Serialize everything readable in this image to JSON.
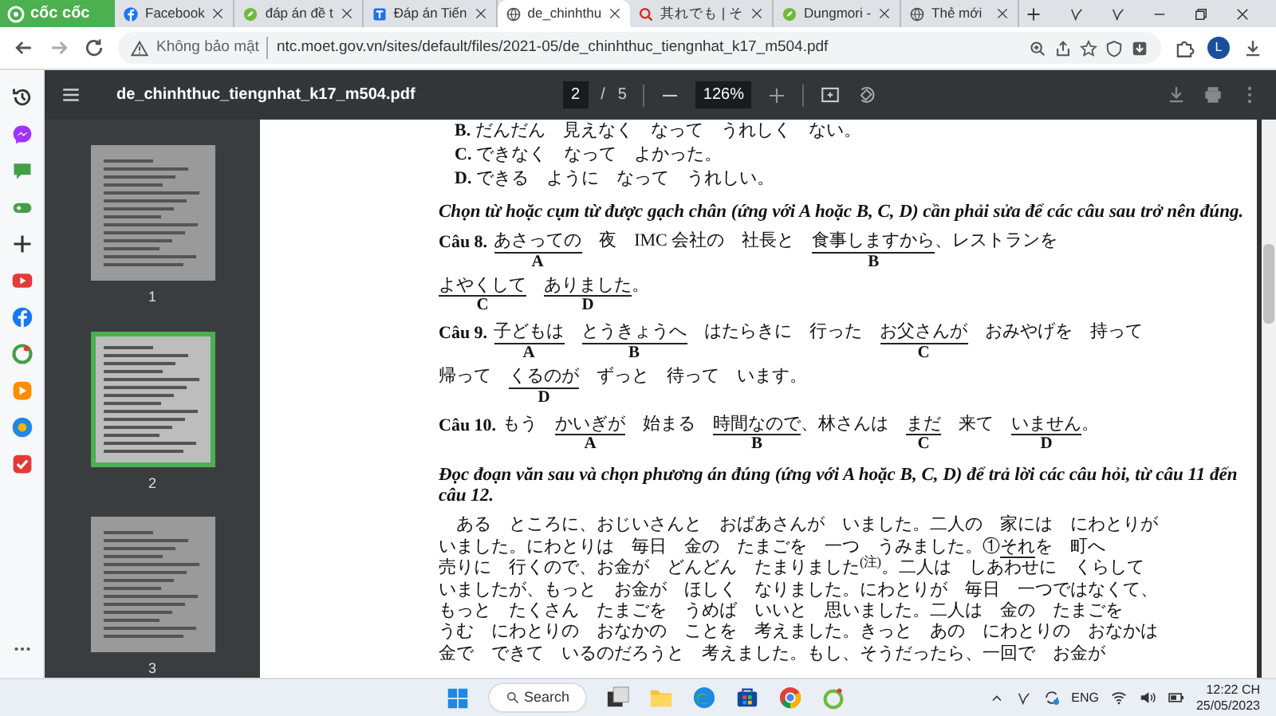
{
  "browser": {
    "brand": "cốc cốc",
    "tabs": [
      {
        "title": "Facebook",
        "selected": false
      },
      {
        "title": "đáp án đề t",
        "selected": false
      },
      {
        "title": "Đáp án Tiến",
        "selected": false
      },
      {
        "title": "de_chinhthu",
        "selected": true
      },
      {
        "title": "其れでも | そ",
        "selected": false
      },
      {
        "title": "Dungmori -",
        "selected": false
      },
      {
        "title": "Thẻ mới",
        "selected": false
      }
    ],
    "address_bar": {
      "security": "Không bảo mật",
      "url": "ntc.moet.gov.vn/sites/default/files/2021-05/de_chinhthuc_tiengnhat_k17_m504.pdf"
    },
    "profile_initial": "L"
  },
  "pdf_viewer": {
    "title": "de_chinhthuc_tiengnhat_k17_m504.pdf",
    "current_page": "2",
    "page_separator": "/",
    "total_pages": "5",
    "zoom": "126%",
    "thumbnails": [
      {
        "label": "1",
        "selected": false
      },
      {
        "label": "2",
        "selected": true
      },
      {
        "label": "3",
        "selected": false
      }
    ]
  },
  "document": {
    "options": [
      {
        "letter": "B.",
        "text": "だんだん　見えなく　なって　うれしく　ない。"
      },
      {
        "letter": "C.",
        "text": "できなく　なって　よかった。"
      },
      {
        "letter": "D.",
        "text": "できる　ように　なって　うれしい。"
      }
    ],
    "instruction_1": "Chọn từ hoặc cụm từ được gạch chân (ứng với A hoặc B, C, D) cần phải sửa để các câu sau trở nên đúng.",
    "questions": [
      {
        "number": "Câu 8.",
        "lines": [
          [
            {
              "text": "あさっての",
              "underlined": true,
              "label": "A"
            },
            {
              "text": "　夜　IMC 会社の　社長と　",
              "underlined": false
            },
            {
              "text": "食事しますから",
              "underlined": true,
              "label": "B"
            },
            {
              "text": "、レストランを",
              "underlined": false
            }
          ],
          [
            {
              "text": "よやくして",
              "underlined": true,
              "label": "C"
            },
            {
              "text": "ありました",
              "underlined": true,
              "label": "D"
            },
            {
              "text": "。",
              "underlined": false
            }
          ]
        ]
      },
      {
        "number": "Câu 9.",
        "lines": [
          [
            {
              "text": "子どもは",
              "underlined": true,
              "label": "A"
            },
            {
              "text": "とうきょうへ",
              "underlined": true,
              "label": "B"
            },
            {
              "text": "　はたらきに　行った　",
              "underlined": false
            },
            {
              "text": "お父さんが",
              "underlined": true,
              "label": "C"
            },
            {
              "text": "　おみやげを　持って",
              "underlined": false
            }
          ],
          [
            {
              "text": "帰って　",
              "underlined": false
            },
            {
              "text": "くるのが",
              "underlined": true,
              "label": "D"
            },
            {
              "text": "　ずっと　待って　います。",
              "underlined": false
            }
          ]
        ]
      },
      {
        "number": "Câu 10.",
        "lines": [
          [
            {
              "text": "もう　",
              "underlined": false
            },
            {
              "text": "かいぎが",
              "underlined": true,
              "label": "A"
            },
            {
              "text": "　始まる　",
              "underlined": false
            },
            {
              "text": "時間なので",
              "underlined": true,
              "label": "B"
            },
            {
              "text": "、林さんは　",
              "underlined": false
            },
            {
              "text": "まだ",
              "underlined": true,
              "label": "C"
            },
            {
              "text": "　来て　",
              "underlined": false
            },
            {
              "text": "いません",
              "underlined": true,
              "label": "D"
            },
            {
              "text": "。",
              "underlined": false
            }
          ]
        ]
      }
    ],
    "instruction_2": "Đọc đoạn văn sau và chọn phương án đúng (ứng với A hoặc B, C, D) để trả lời các câu hỏi, từ câu 11 đến câu 12.",
    "passage": [
      [
        {
          "text": "　ある　ところに、おじいさんと　おばあさんが　いました。二人の　家には　にわとりが",
          "underlined": false
        }
      ],
      [
        {
          "text": "いました。にわとりは　毎日　金の　たまごを　一つ　うみました。①",
          "underlined": false
        },
        {
          "text": "それ",
          "underlined": true
        },
        {
          "text": "を　町へ",
          "underlined": false
        }
      ],
      [
        {
          "text": "売りに　行くので、お金が　どんどん　たまりました$^{(注)}$。二人は　しあわせに　くらして",
          "underlined": false
        }
      ],
      [
        {
          "text": "いましたが、もっと　お金が　ほしく　なりました。にわとりが　毎日　一つではなくて、",
          "underlined": false
        }
      ],
      [
        {
          "text": "もっと　たくさん　たまごを　うめば　いいと　思いました。二人は　金の　たまごを",
          "underlined": false
        }
      ],
      [
        {
          "text": "うむ　にわとりの　おなかの　ことを　考えました。きっと　あの　にわとりの　おなかは",
          "underlined": false
        }
      ],
      [
        {
          "text": "金で　できて　いるのだろうと　考えました。もし、そうだったら、一回で　お金が",
          "underlined": false
        }
      ]
    ]
  },
  "taskbar": {
    "search": "Search",
    "language": "ENG",
    "time": "12:22 CH",
    "date": "25/05/2023"
  }
}
